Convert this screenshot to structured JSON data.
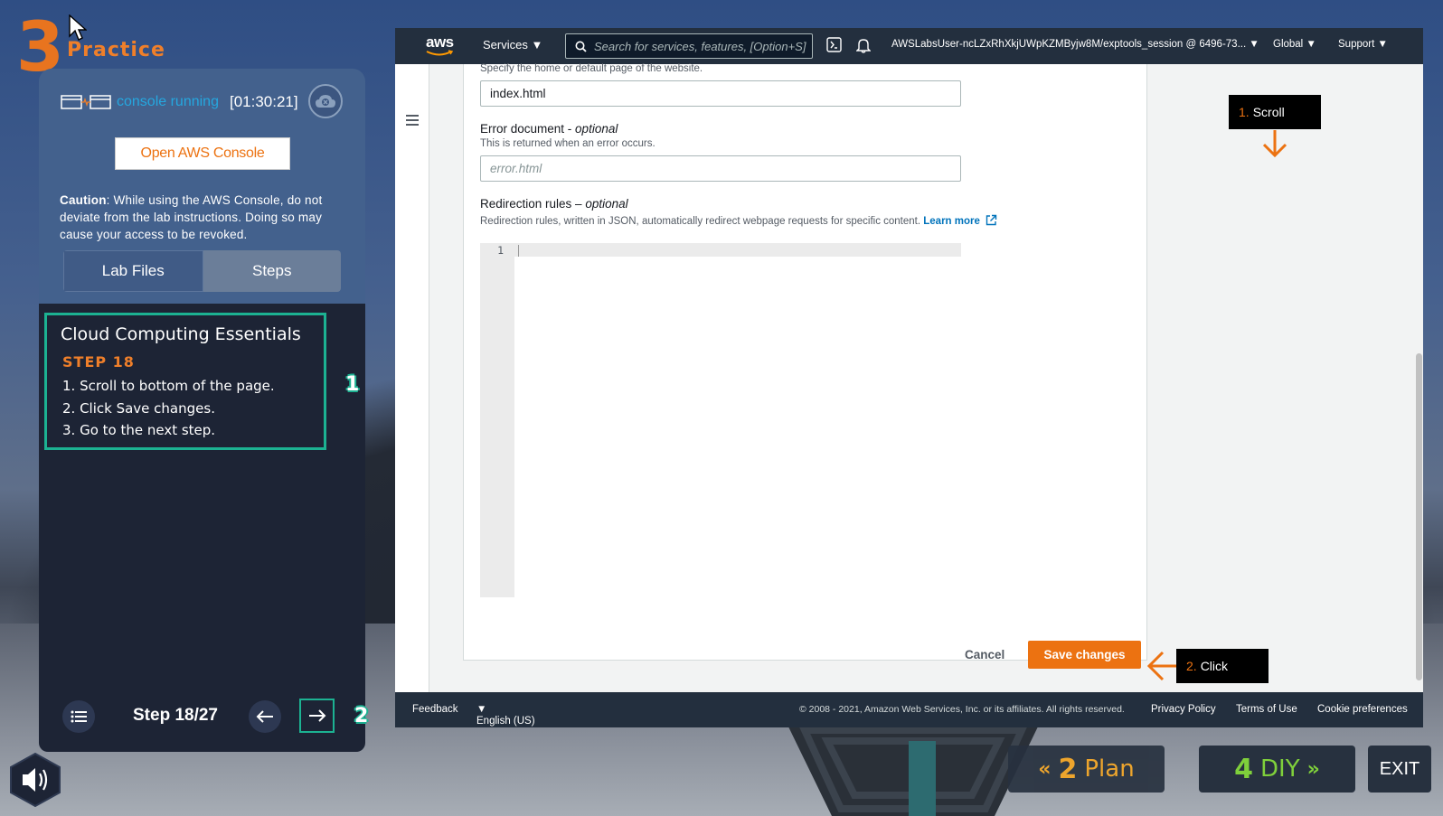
{
  "practice": {
    "number": "3",
    "label": "Practice"
  },
  "lab": {
    "status_text": "console running",
    "timer": "[01:30:21]",
    "open_console_label": "Open AWS Console",
    "caution_bold": "Caution",
    "caution_text": ": While using the AWS Console, do not deviate from the lab instructions. Doing so may cause your access to be revoked.",
    "tabs": [
      {
        "label": "Lab Files"
      },
      {
        "label": "Steps"
      }
    ],
    "course_title": "Cloud Computing Essentials",
    "step_label": "STEP 18",
    "instructions": [
      "1. Scroll to bottom of the page.",
      "2. Click Save changes.",
      "3. Go to the next step."
    ],
    "marker1": "1",
    "marker2": "2",
    "step_counter": "Step 18/27"
  },
  "aws": {
    "logo": "aws",
    "services_label": "Services",
    "search_placeholder": "Search for services, features, [Option+S]",
    "user": "AWSLabsUser-ncLZxRhXkjUWpKZMByjw8M/exptools_session @ 6496-73...",
    "region": "Global",
    "support": "Support",
    "index_hint": "Specify the home or default page of the website.",
    "index_value": "index.html",
    "error_label": "Error document - ",
    "error_optional": "optional",
    "error_desc": "This is returned when an error occurs.",
    "error_placeholder": "error.html",
    "redirect_label": "Redirection rules – ",
    "redirect_optional": "optional",
    "redirect_desc": "Redirection rules, written in JSON, automatically redirect webpage requests for specific content.",
    "learn_more": "Learn more",
    "line_number": "1",
    "cancel_label": "Cancel",
    "save_label": "Save changes",
    "footer": {
      "feedback": "Feedback",
      "language": "English (US)",
      "copyright": "© 2008 - 2021, Amazon Web Services, Inc. or its affiliates. All rights reserved.",
      "privacy": "Privacy Policy",
      "terms": "Terms of Use",
      "cookies": "Cookie preferences"
    }
  },
  "callouts": {
    "scroll_num": "1.",
    "scroll_text": "Scroll",
    "click_num": "2.",
    "click_text": "Click"
  },
  "nav_buttons": {
    "plan_num": "2",
    "plan_label": "Plan",
    "diy_num": "4",
    "diy_label": "DIY",
    "exit_label": "EXIT"
  },
  "colors": {
    "aws_orange": "#ec7211",
    "accent_teal": "#1cb292",
    "nav_dark": "#232f3e"
  }
}
